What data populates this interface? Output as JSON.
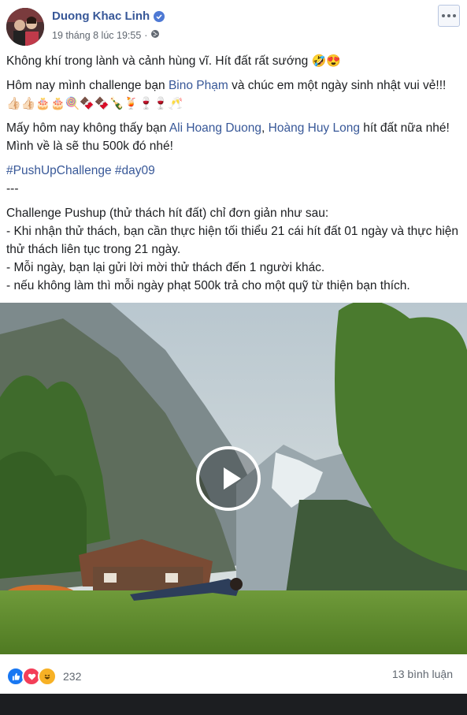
{
  "post": {
    "author": "Duong Khac Linh",
    "timestamp": "19 tháng 8 lúc 19:55",
    "separator": "·",
    "audience_icon": "globe-icon",
    "more_icon": "more-options-icon"
  },
  "content": {
    "line1": "Không khí trong lành và cảnh hùng vĩ. Hít đất rất sướng",
    "line1_emoji": "🤣😍",
    "line2_a": "Hôm nay mình challenge bạn ",
    "line2_mention": "Bino Phạm",
    "line2_b": " và chúc em một ngày sinh nhật vui vẻ!!! ",
    "line2_emoji": "👍🏻👍🏻🎂🎂🍭🍫🍫🍾🍹🍷🍷🥂",
    "line3_a": "Mấy hôm nay không thấy bạn ",
    "line3_mention1": "Ali Hoang Duong",
    "line3_sep": ", ",
    "line3_mention2": "Hoàng Huy Long",
    "line3_b": " hít đất nữa nhé! Mình về là sẽ thu 500k đó nhé!",
    "hashtag1": "#PushUpChallenge",
    "hashtag2": "#day09",
    "divider": "---",
    "rules_intro": "Challenge Pushup (thử thách hít đất) chỉ đơn giản như sau:",
    "rule1": "- Khi nhận thử thách, bạn cần thực hiện tối thiểu 21 cái hít đất 01 ngày và thực hiện thử thách liên tục trong 21 ngày.",
    "rule2": "- Mỗi ngày, bạn lại gửi lời mời thử thách đến 1 người khác.",
    "rule3": "- nếu không làm thì mỗi ngày phạt 500k trả cho một quỹ từ thiện bạn thích."
  },
  "video": {
    "play_icon": "play-icon"
  },
  "footer": {
    "reaction_icons": [
      "like-icon",
      "love-icon",
      "haha-icon"
    ],
    "reaction_count": "232",
    "comments": "13 bình luận"
  },
  "colors": {
    "link": "#385898",
    "text": "#1c1e21",
    "meta": "#606770",
    "like": "#1877f2",
    "love": "#f33e58",
    "haha": "#f7b125"
  }
}
